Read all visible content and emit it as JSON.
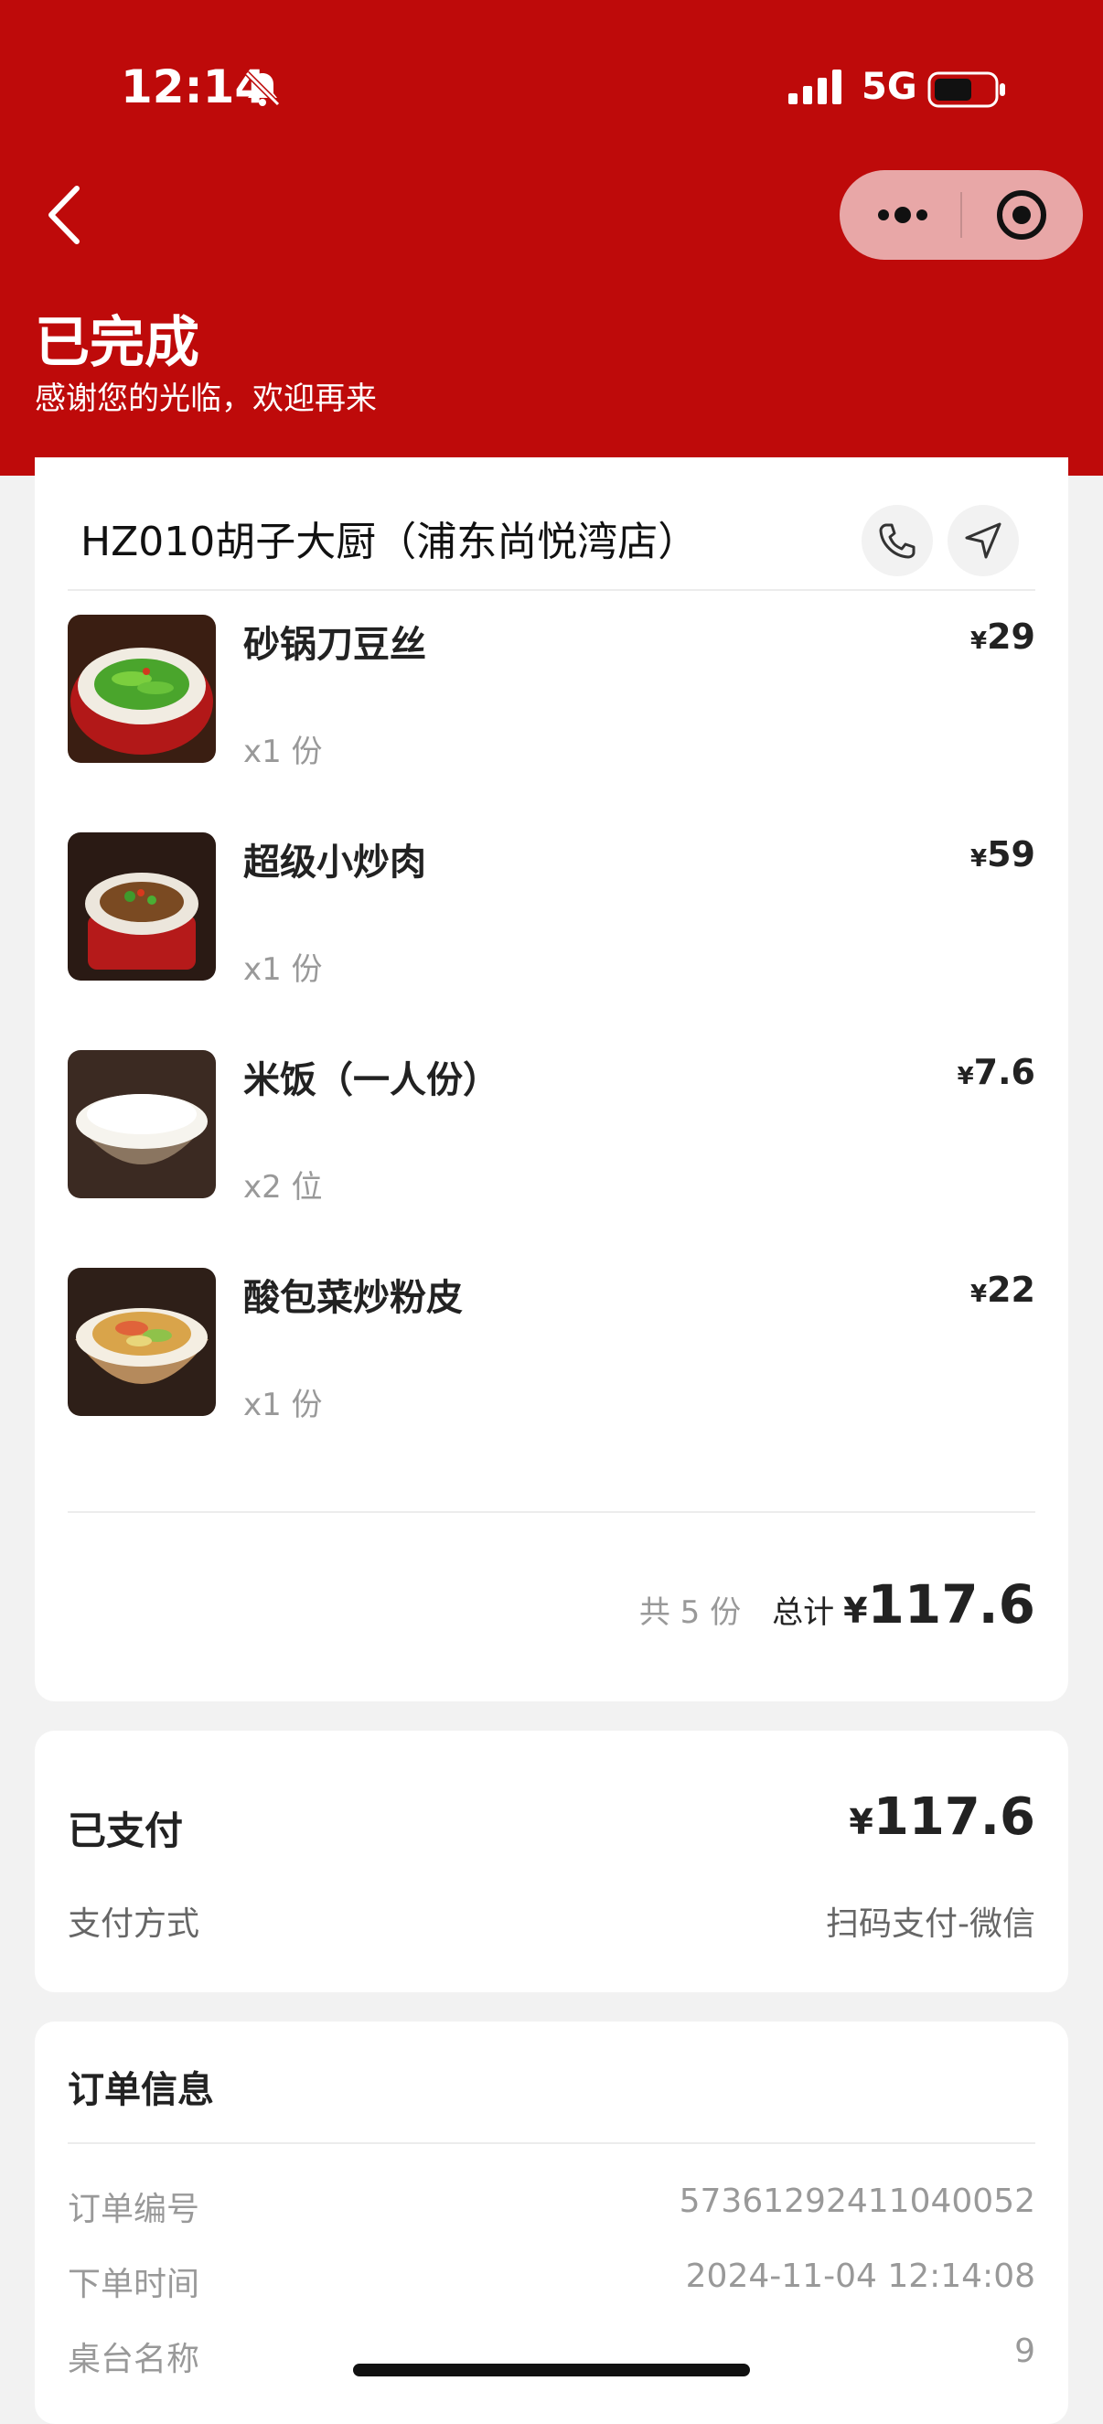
{
  "status_bar": {
    "time": "12:14",
    "network": "5G"
  },
  "header": {
    "title": "已完成",
    "subtitle": "感谢您的光临，欢迎再来",
    "accent_color": "#be0a0a"
  },
  "shop": {
    "name": "HZ010胡子大厨（浦东尚悦湾店）"
  },
  "items": [
    {
      "name": "砂锅刀豆丝",
      "qty": "x1 份",
      "currency": "¥",
      "price": "29",
      "image": "green-beans-dish"
    },
    {
      "name": "超级小炒肉",
      "qty": "x1 份",
      "currency": "¥",
      "price": "59",
      "image": "stir-fried-pork-dish"
    },
    {
      "name": "米饭（一人份）",
      "qty": "x2 位",
      "currency": "¥",
      "price": "7.6",
      "image": "rice-bowl"
    },
    {
      "name": "酸包菜炒粉皮",
      "qty": "x1 份",
      "currency": "¥",
      "price": "22",
      "image": "cabbage-noodle-dish"
    }
  ],
  "summary": {
    "count": "共 5 份",
    "total_label": "总计",
    "currency": "¥",
    "total": "117.6"
  },
  "payment": {
    "status": "已支付",
    "currency": "¥",
    "amount": "117.6",
    "method_label": "支付方式",
    "method_value": "扫码支付-微信"
  },
  "order_info": {
    "title": "订单信息",
    "rows": [
      {
        "label": "订单编号",
        "value": "57361292411040052"
      },
      {
        "label": "下单时间",
        "value": "2024-11-04 12:14:08"
      },
      {
        "label": "桌台名称",
        "value": "9"
      }
    ]
  }
}
